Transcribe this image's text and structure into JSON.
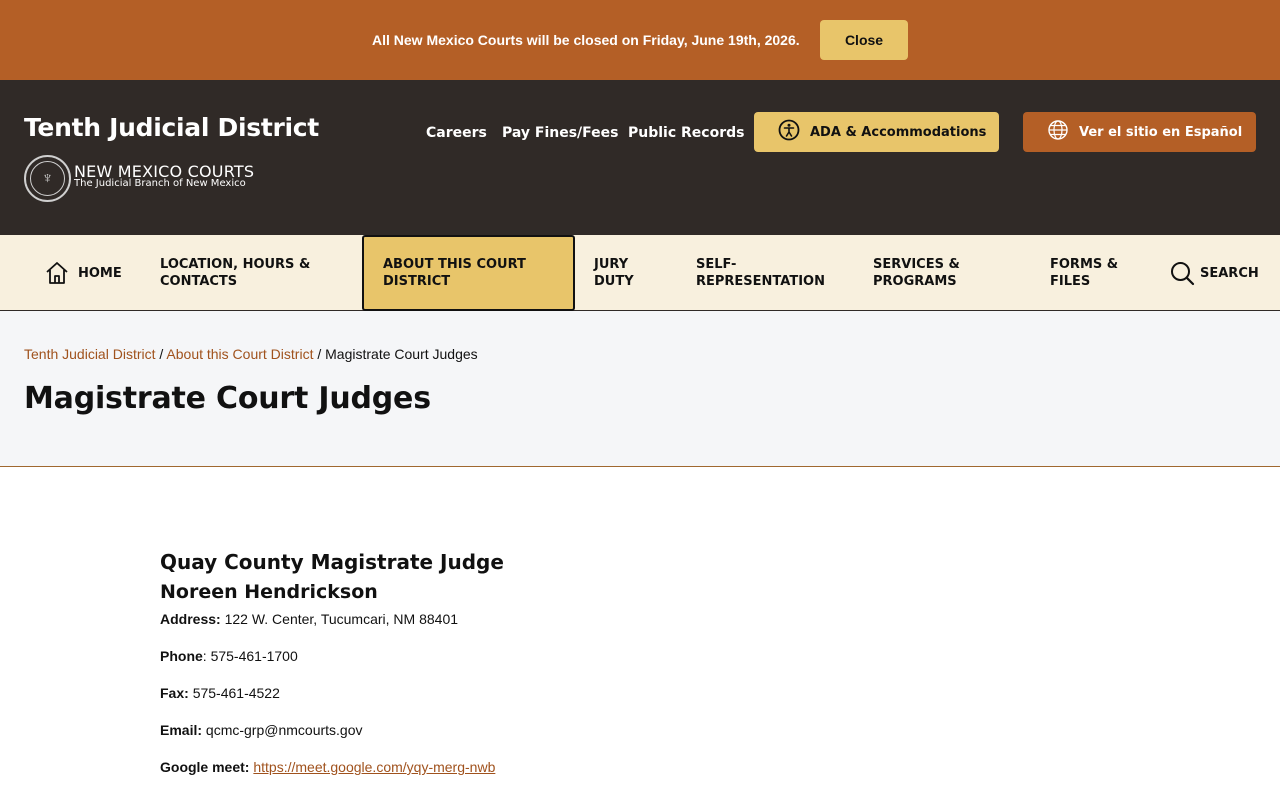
{
  "alert": {
    "message": "All New Mexico Courts will be closed on Friday, June 19th, 2026.",
    "close_label": "Close"
  },
  "header": {
    "site_title": "Tenth Judicial District",
    "brand_name": "NEW MEXICO COURTS",
    "brand_tagline": "The Judicial Branch of New Mexico",
    "links": [
      "Careers",
      "Pay Fines/Fees",
      "Public Records"
    ],
    "ada_label": "ADA & Accommodations",
    "spanish_label": "Ver el sitio en Español"
  },
  "nav": {
    "home": "HOME",
    "location": "LOCATION, HOURS & CONTACTS",
    "about": "ABOUT THIS COURT DISTRICT",
    "jury": "JURY DUTY",
    "self_rep": "SELF-REPRESENTATION",
    "services": "SERVICES & PROGRAMS",
    "forms": "FORMS & FILES",
    "search": "SEARCH"
  },
  "breadcrumb": {
    "item1": "Tenth Judicial District",
    "item2": "About this Court District",
    "current": "Magistrate Court Judges"
  },
  "page_title": "Magistrate Court Judges",
  "judge": {
    "county_heading": "Quay County Magistrate Judge",
    "name": "Noreen Hendrickson",
    "address_label": "Address:",
    "address": "122 W. Center, Tucumcari, NM 88401",
    "phone_label": "Phone",
    "phone": "575-461-1700",
    "fax_label": "Fax:",
    "fax": "575-461-4522",
    "email_label": "Email:",
    "email": "qcmc-grp@nmcourts.gov",
    "meet_label": "Google meet:",
    "meet_link": "https://meet.google.com/yqy-merg-nwb"
  },
  "colors": {
    "accent": "#b45f26",
    "header_bg": "#302a27",
    "button_gold": "#e8c56a",
    "nav_bg": "#f8f0de"
  }
}
